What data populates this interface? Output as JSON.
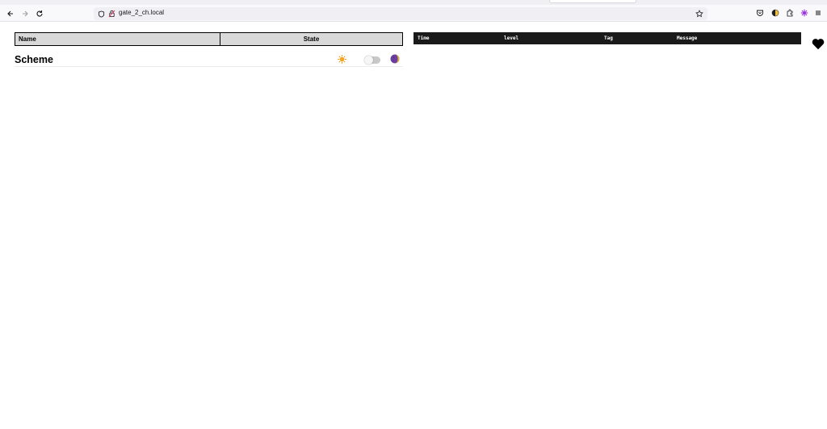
{
  "browser": {
    "url": "gate_2_ch.local"
  },
  "state_table": {
    "headers": [
      "Name",
      "State"
    ]
  },
  "scheme": {
    "title": "Scheme",
    "toggle_on": false
  },
  "log_table": {
    "headers": [
      "Time",
      "level",
      "Tag",
      "Message"
    ]
  },
  "icons": {
    "sun": "sun-icon",
    "moon": "moon-icon",
    "heart": "heart-icon"
  },
  "colors": {
    "log_header_bg": "#1a1a1a",
    "state_header_bg": "#d9d9d9",
    "sun": "#f5a623",
    "moon": "#6b3fa0"
  }
}
